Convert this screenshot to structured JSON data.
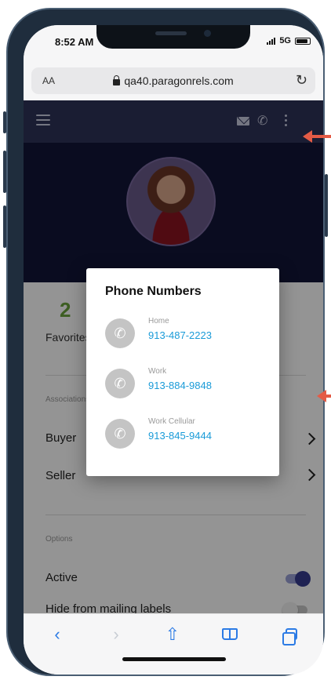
{
  "status_bar": {
    "time": "8:52 AM",
    "network": "5G"
  },
  "browser": {
    "text_size_label": "AA",
    "url": "qa40.paragonrels.com"
  },
  "page": {
    "favorites": {
      "count": "2",
      "label": "Favorites"
    },
    "associations_label": "Associations",
    "associations": [
      {
        "label": "Buyer"
      },
      {
        "label": "Seller"
      }
    ],
    "options_label": "Options",
    "options": [
      {
        "label": "Active",
        "enabled": true
      },
      {
        "label": "Hide from mailing labels",
        "enabled": false
      }
    ]
  },
  "modal": {
    "title": "Phone Numbers",
    "numbers": [
      {
        "type": "Home",
        "number": "913-487-2223"
      },
      {
        "type": "Work",
        "number": "913-884-9848"
      },
      {
        "type": "Work Cellular",
        "number": "913-845-9444"
      }
    ]
  },
  "icons": {
    "menu": "hamburger-icon",
    "mail": "mail-icon",
    "phone": "phone-icon",
    "more": "more-vertical-icon",
    "lock": "lock-icon",
    "reload": "reload-icon",
    "back": "chevron-left-icon",
    "forward": "chevron-right-icon",
    "share": "share-icon",
    "bookmarks": "book-icon",
    "tabs": "tabs-icon"
  },
  "colors": {
    "app_bar": "#2e3358",
    "profile_header": "#121638",
    "favorites_count": "#6aa33c",
    "phone_link": "#1a9bd8",
    "toggle_active": "#363c8f",
    "safari_blue": "#2c7be5",
    "annotation_arrow": "#e45b46"
  }
}
